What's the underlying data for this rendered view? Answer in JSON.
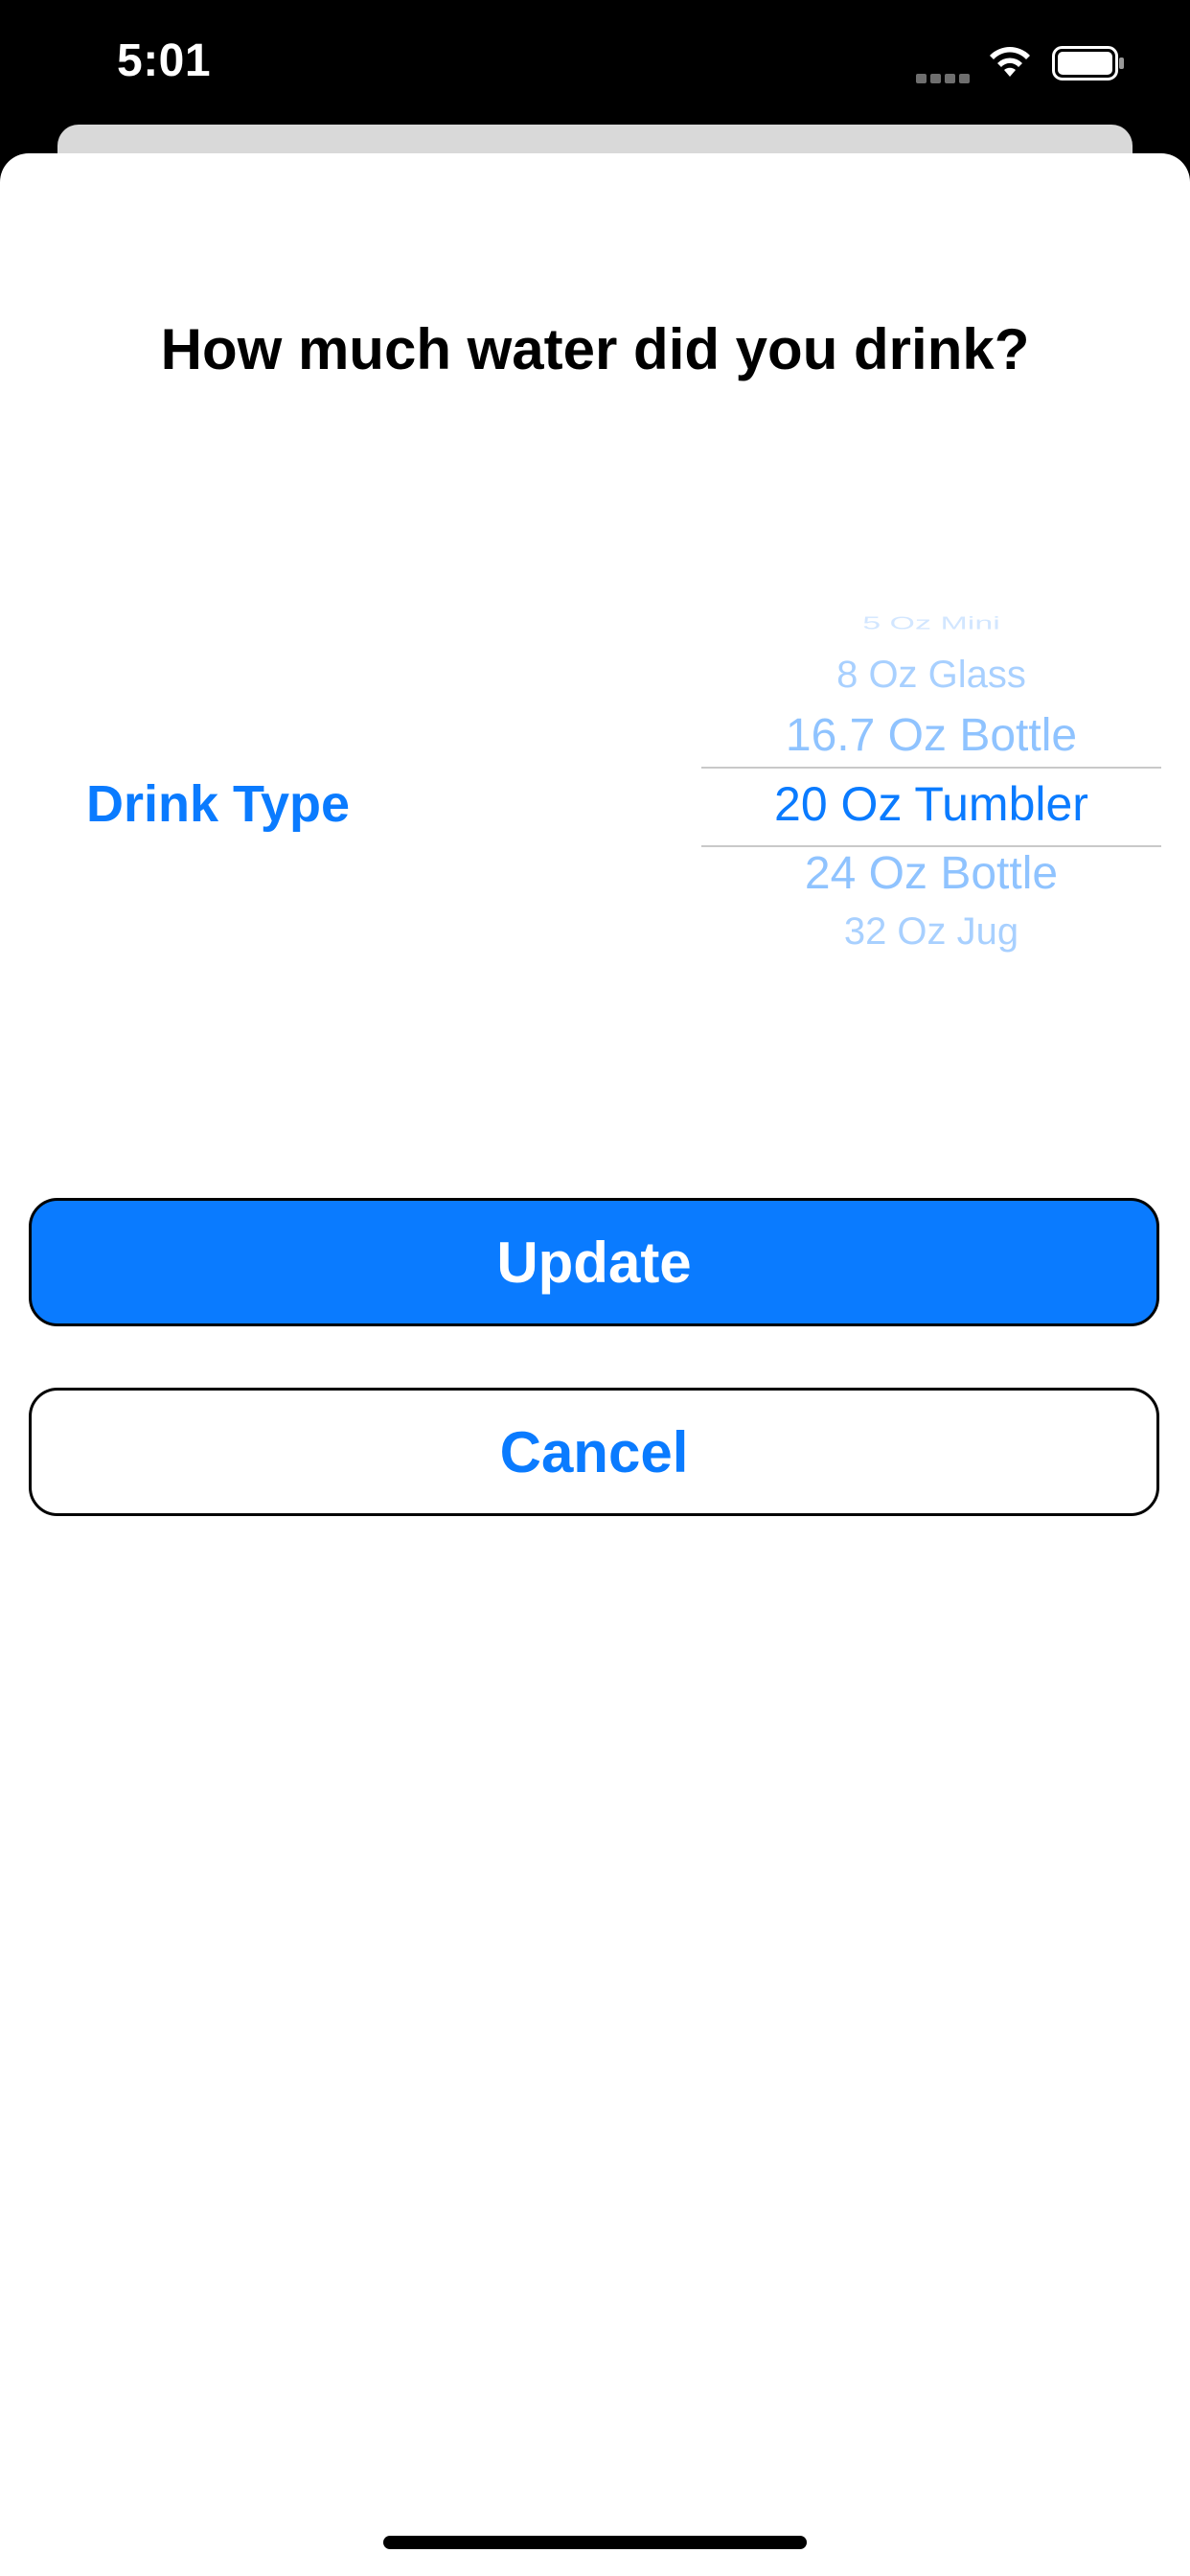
{
  "status_bar": {
    "time": "5:01",
    "icons": [
      "cellular-dots-icon",
      "wifi-icon",
      "battery-icon"
    ]
  },
  "sheet": {
    "title": "How much water did you drink?"
  },
  "form": {
    "drink_type_label": "Drink Type",
    "picker": {
      "options": [
        "5 Oz Mini",
        "8 Oz Glass",
        "16.7 Oz Bottle",
        "20 Oz Tumbler",
        "24 Oz Bottle",
        "32 Oz Jug"
      ],
      "selected": "20 Oz Tumbler"
    }
  },
  "buttons": {
    "update_label": "Update",
    "cancel_label": "Cancel"
  },
  "colors": {
    "accent": "#0a7bff",
    "background": "#ffffff",
    "status_bar": "#000000"
  }
}
